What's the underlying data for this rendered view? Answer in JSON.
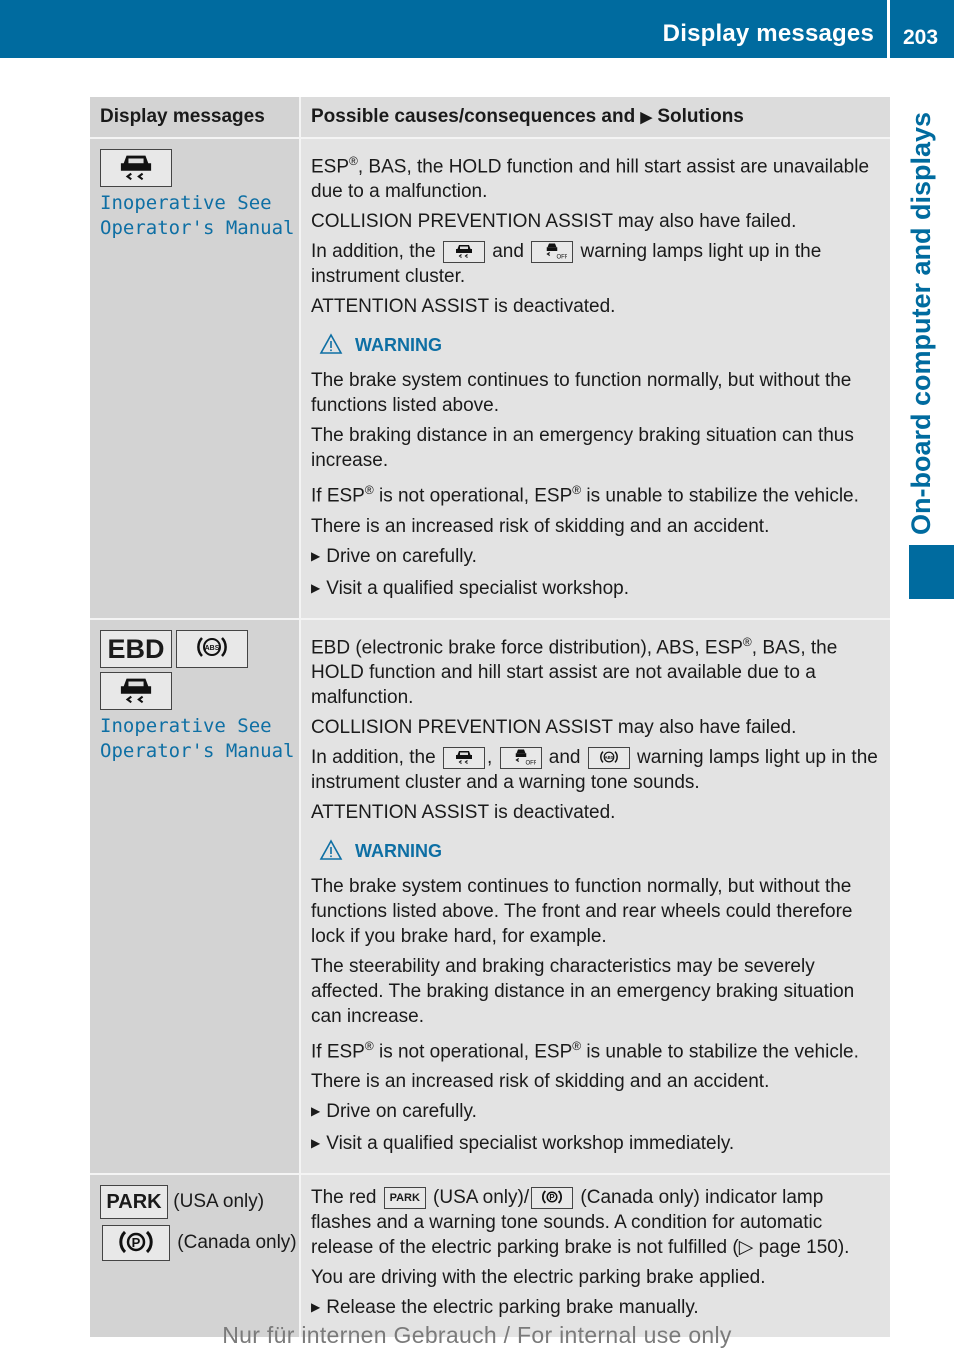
{
  "header": {
    "section_title": "Display messages",
    "page_number": "203",
    "side_label": "On-board computer and displays"
  },
  "table": {
    "col1_header": "Display messages",
    "col2_header_a": "Possible causes/consequences and",
    "col2_header_arrow": "▶",
    "col2_header_b": "Solutions",
    "rows": [
      {
        "message": [
          "Inoperative See",
          "Operator's Manual"
        ],
        "p1_a": "ESP",
        "p1_b": ", BAS, the HOLD function and hill start assist are unavailable due to a malfunction.",
        "p2": "COLLISION PREVENTION ASSIST may also have failed.",
        "p3_a": "In addition, the",
        "p3_b": "and",
        "p3_c": "warning lamps light up in the instrument cluster.",
        "p4": "ATTENTION ASSIST is deactivated.",
        "warning_label": "WARNING",
        "w1": "The brake system continues to function normally, but without the functions listed above.",
        "w2": "The braking distance in an emergency braking situation can thus increase.",
        "w3_a": "If ESP",
        "w3_b": " is not operational, ESP",
        "w3_c": " is unable to stabilize the vehicle.",
        "w4": "There is an increased risk of skidding and an accident.",
        "b1": "Drive on carefully.",
        "b2": "Visit a qualified specialist workshop."
      },
      {
        "ebd_label": "EBD",
        "message": [
          "Inoperative See",
          "Operator's Manual"
        ],
        "p1_a": "EBD (electronic brake force distribution), ABS, ESP",
        "p1_b": ", BAS, the HOLD function and hill start assist are not available due to a malfunction.",
        "p2": "COLLISION PREVENTION ASSIST may also have failed.",
        "p3_a": "In addition, the",
        "p3_comma": ",",
        "p3_b": "and",
        "p3_c": "warning lamps light up in the instrument cluster and a warning tone sounds.",
        "p4": "ATTENTION ASSIST is deactivated.",
        "warning_label": "WARNING",
        "w1": "The brake system continues to function normally, but without the functions listed above. The front and rear wheels could therefore lock if you brake hard, for example.",
        "w2": "The steerability and braking characteristics may be severely affected. The braking distance in an emergency braking situation can increase.",
        "w3_a": "If ESP",
        "w3_b": " is not operational, ESP",
        "w3_c": " is unable to stabilize the vehicle.",
        "w4": "There is an increased risk of skidding and an accident.",
        "b1": "Drive on carefully.",
        "b2": "Visit a qualified specialist workshop immediately."
      },
      {
        "park_label": "PARK",
        "usa_only": "(USA only)",
        "canada_only": "(Canada only)",
        "p_symbol": "P",
        "p1_a": "The red",
        "p1_b": "(USA only)/",
        "p1_c": "(Canada only) indicator lamp flashes and a warning tone sounds. A condition for automatic release of the electric parking brake is not fulfilled (▷ page 150).",
        "p2": "You are driving with the electric parking brake applied.",
        "b1": "Release the electric parking brake manually."
      }
    ]
  },
  "registered": "®",
  "footer": "Nur für internen Gebrauch / For internal use only"
}
